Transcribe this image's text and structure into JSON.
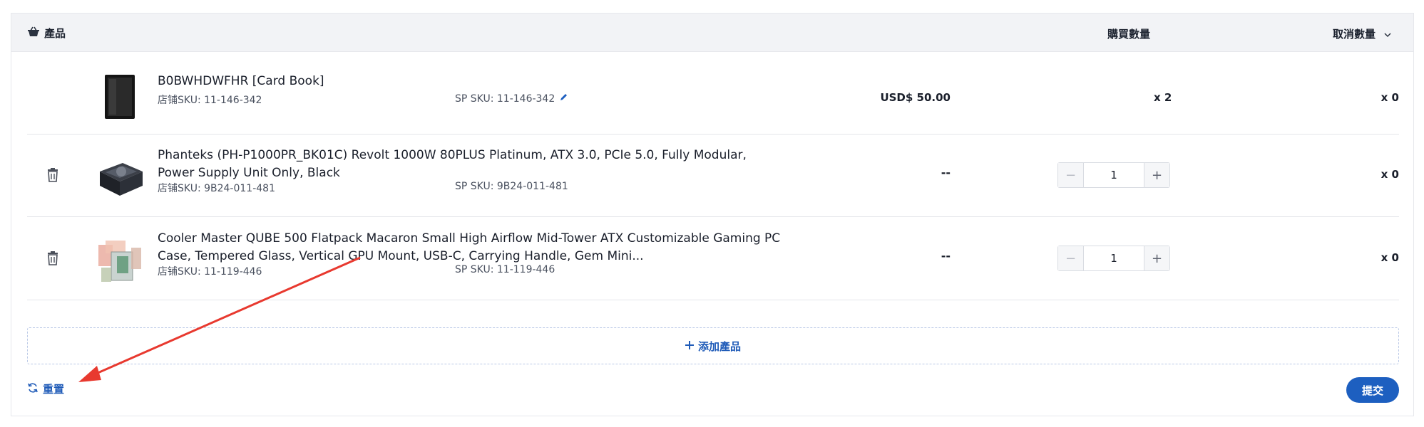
{
  "header": {
    "product_label": "產品",
    "buy_qty_label": "購買數量",
    "cancel_qty_label": "取消數量"
  },
  "rows": [
    {
      "name": "B0BWHDWFHR [Card Book]",
      "store_sku": "店铺SKU: 11-146-342",
      "sp_sku": "SP SKU: 11-146-342",
      "price": "USD$ 50.00",
      "buy_qty": "x 2",
      "cancel_qty": "x 0"
    },
    {
      "name": "Phanteks (PH-P1000PR_BK01C) Revolt 1000W 80PLUS Platinum, ATX 3.0, PCIe 5.0, Fully Modular, Power Supply Unit Only, Black",
      "store_sku": "店铺SKU: 9B24-011-481",
      "sp_sku": "SP SKU: 9B24-011-481",
      "price": "--",
      "qty_value": "1",
      "cancel_qty": "x 0"
    },
    {
      "name": "Cooler Master QUBE 500 Flatpack Macaron Small High Airflow Mid-Tower ATX Customizable Gaming PC Case, Tempered Glass, Vertical GPU Mount, USB-C, Carrying Handle, Gem Mini...",
      "store_sku": "店铺SKU: 11-119-446",
      "sp_sku": "SP SKU: 11-119-446",
      "price": "--",
      "qty_value": "1",
      "cancel_qty": "x 0"
    }
  ],
  "stepper": {
    "minus": "−",
    "plus": "+"
  },
  "add_product_label": "添加產品",
  "reset_label": "重置",
  "submit_label": "提交",
  "colors": {
    "accent": "#1d5fc0",
    "header_bg": "#f2f3f6",
    "annotation_arrow": "#e8392f"
  }
}
